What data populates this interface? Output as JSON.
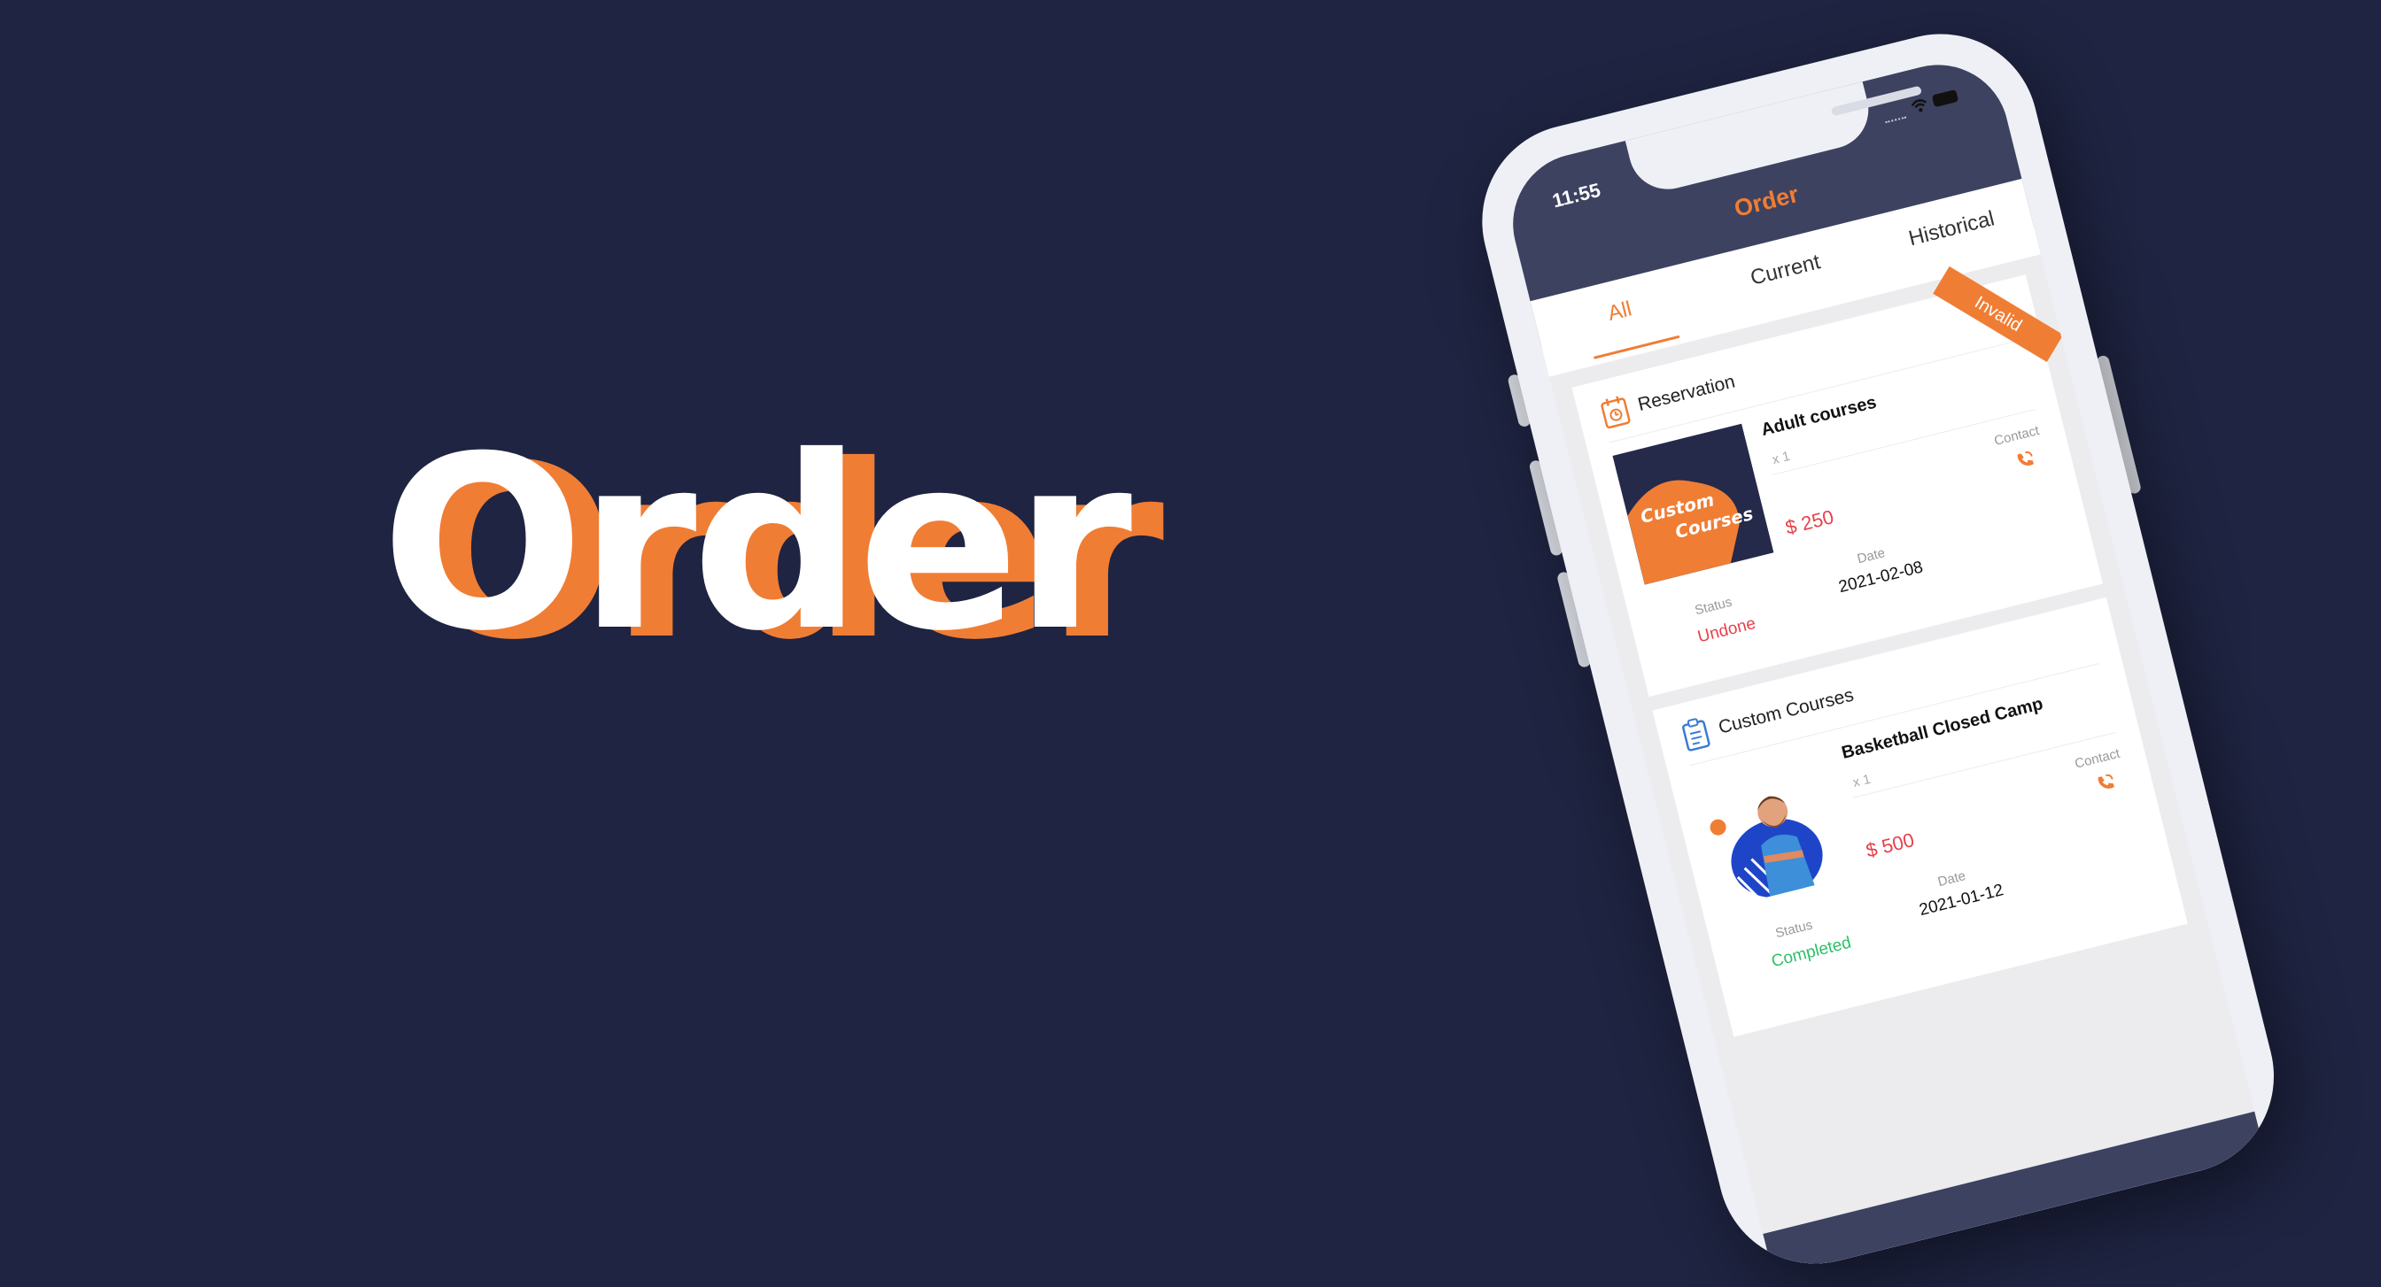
{
  "hero": {
    "title": "Order"
  },
  "status_bar": {
    "time": "11:55",
    "icons": [
      "signal-icon",
      "wifi-icon",
      "battery-icon"
    ]
  },
  "app": {
    "title": "Order"
  },
  "tabs": [
    {
      "label": "All",
      "active": true
    },
    {
      "label": "Current",
      "active": false
    },
    {
      "label": "Historical",
      "active": false
    }
  ],
  "orders": [
    {
      "category": "Reservation",
      "category_icon": "calendar-clock-icon",
      "course_name": "Adult courses",
      "quantity": "x 1",
      "price": "$ 250",
      "thumb_text_1": "Custom",
      "thumb_text_2": "Courses",
      "contact_label": "Contact",
      "status_label": "Status",
      "status": "Undone",
      "date_label": "Date",
      "date": "2021-02-08",
      "ribbon": "Invalid"
    },
    {
      "category": "Custom Courses",
      "category_icon": "clipboard-list-icon",
      "course_name": "Basketball Closed Camp",
      "quantity": "x 1",
      "price": "$ 500",
      "contact_label": "Contact",
      "status_label": "Status",
      "status": "Completed",
      "date_label": "Date",
      "date": "2021-01-12"
    }
  ],
  "colors": {
    "background": "#1f2442",
    "accent": "#f07d34",
    "price": "#e8404a",
    "undone": "#e8404a",
    "completed": "#2dbf6a",
    "header": "#3d4260"
  }
}
